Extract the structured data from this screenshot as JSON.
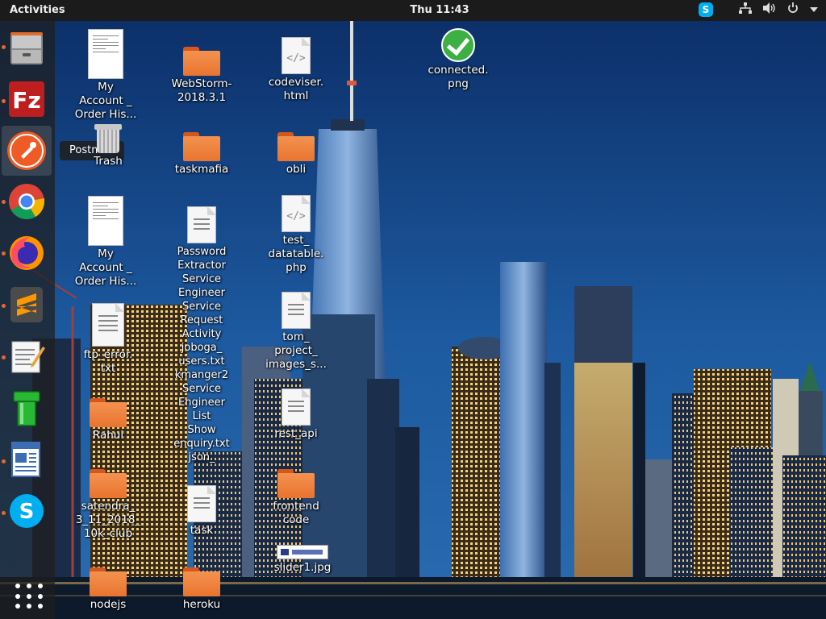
{
  "topbar": {
    "activities": "Activities",
    "clock": "Thu 11:43",
    "tray_icons": [
      "skype-icon",
      "network-icon",
      "volume-icon",
      "power-icon",
      "chevron-down-icon"
    ]
  },
  "dock": {
    "items": [
      {
        "name": "files-app-icon",
        "running": true
      },
      {
        "name": "filezilla-app-icon",
        "running": true
      },
      {
        "name": "postman-app-icon",
        "running": true,
        "active": true
      },
      {
        "name": "chrome-app-icon",
        "running": true
      },
      {
        "name": "firefox-app-icon",
        "running": true
      },
      {
        "name": "sublime-text-app-icon",
        "running": true
      },
      {
        "name": "text-editor-app-icon",
        "running": true
      },
      {
        "name": "green-pipe-app-icon",
        "running": false
      },
      {
        "name": "libreoffice-writer-app-icon",
        "running": true
      },
      {
        "name": "skype-app-icon",
        "running": true
      }
    ],
    "show_apps_icon": "grid-icon"
  },
  "tooltip": "Postman",
  "desktop": {
    "icons": [
      {
        "type": "pdf",
        "label": "My\nAccount _\nOrder His..."
      },
      {
        "type": "trash",
        "label": "Trash"
      },
      {
        "type": "pdf",
        "label": "My\nAccount _\nOrder His..."
      },
      {
        "type": "doc",
        "label": "ftp_error.\ntxt"
      },
      {
        "type": "folder",
        "label": "Rahul"
      },
      {
        "type": "folder",
        "label": "satendra_\n3_11_2018_\n10k_club"
      },
      {
        "type": "folder",
        "label": "nodejs"
      },
      {
        "type": "folder",
        "label": "WebStorm-\n2018.3.1"
      },
      {
        "type": "folder",
        "label": "taskmafia"
      },
      {
        "type": "doc",
        "label": "Password\nExtractor\nService\nEngineer\nService\nRequest\nActivity\njoboga_\nusers.txt\nkmanger2\nService\nEngineer\nList\nShow\nenquiry.txt\njson_"
      },
      {
        "type": "doc",
        "label": "task"
      },
      {
        "type": "folder",
        "label": "heroku"
      },
      {
        "type": "code",
        "label": "codeviser.\nhtml"
      },
      {
        "type": "folder",
        "label": "obli"
      },
      {
        "type": "code",
        "label": "test_\ndatatable.\nphp"
      },
      {
        "type": "doc",
        "label": "tom_\nproject_\nimages_s..."
      },
      {
        "type": "doc",
        "label": "rest_api"
      },
      {
        "type": "folder",
        "label": "frontend\ncode"
      },
      {
        "type": "image",
        "label": "slider1.jpg"
      },
      {
        "type": "check",
        "label": "connected.\npng"
      }
    ]
  }
}
